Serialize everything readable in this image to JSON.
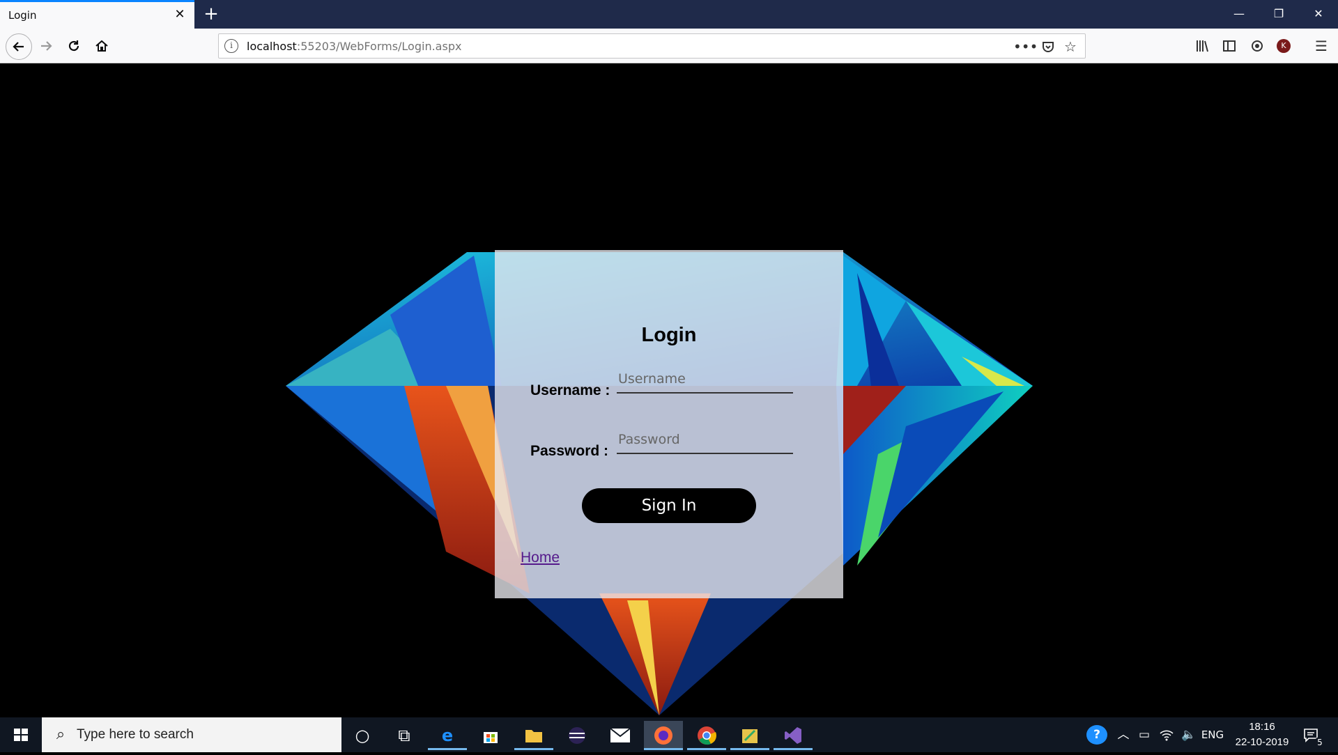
{
  "browser": {
    "tab_title": "Login",
    "tab_close_glyph": "✕",
    "new_tab_glyph": "+",
    "window_controls": {
      "minimize": "—",
      "restore": "❐",
      "close": "✕"
    },
    "url_host": "localhost",
    "url_rest": ":55203/WebForms/Login.aspx",
    "nav_icons": [
      "back-arrow-icon",
      "forward-arrow-icon",
      "reload-icon",
      "home-icon"
    ],
    "url_icons": [
      "page-actions-menu-icon",
      "pocket-icon",
      "bookmark-star-icon"
    ],
    "toolbar_icons": [
      "library-icon",
      "sidebar-icon",
      "sync-icon",
      "account-avatar-icon",
      "hamburger-menu-icon"
    ],
    "avatar_letter": "K"
  },
  "login": {
    "title": "Login",
    "username_label": "Username :",
    "username_placeholder": "Username",
    "password_label": "Password :",
    "password_placeholder": "Password",
    "signin_label": "Sign In",
    "home_link": "Home"
  },
  "taskbar": {
    "search_placeholder": "Type here to search",
    "apps": [
      "cortana-icon",
      "task-view-icon",
      "edge-icon",
      "store-icon",
      "file-explorer-icon",
      "eclipse-icon",
      "mail-icon",
      "firefox-icon",
      "chrome-icon",
      "tools-icon",
      "visual-studio-icon"
    ],
    "tray": {
      "language": "ENG",
      "time": "18:16",
      "date": "22-10-2019",
      "notification_count": "5"
    }
  },
  "colors": {
    "tab_accent": "#0a84ff",
    "tabbar_bg": "#1f2a4a",
    "taskbar_bg": "#101722",
    "link_color": "#551a8b",
    "button_bg": "#000000"
  }
}
